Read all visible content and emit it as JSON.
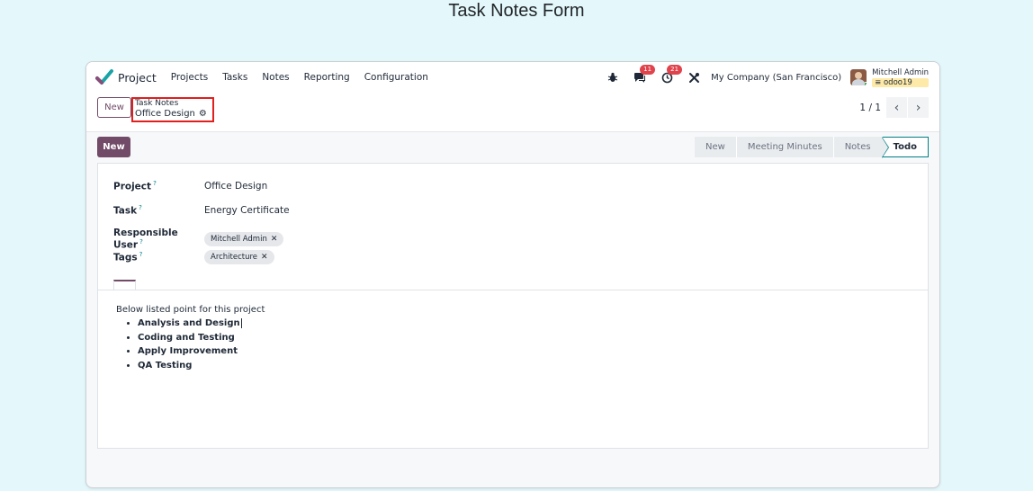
{
  "page_title": "Task Notes Form",
  "navbar": {
    "app_name": "Project",
    "menu": [
      "Projects",
      "Tasks",
      "Notes",
      "Reporting",
      "Configuration"
    ],
    "messages_badge": "11",
    "activities_badge": "21",
    "company": "My Company (San Francisco)",
    "user_name": "Mitchell Admin",
    "database": "odoo19"
  },
  "control_panel": {
    "new_label": "New",
    "breadcrumb_parent": "Task Notes",
    "breadcrumb_current": "Office Design",
    "pager": "1 / 1"
  },
  "statusbar": {
    "new_button": "New",
    "stages": [
      "New",
      "Meeting Minutes",
      "Notes",
      "Todo"
    ],
    "active_stage": "Todo"
  },
  "form": {
    "fields": [
      {
        "label": "Project",
        "value": "Office Design"
      },
      {
        "label": "Task",
        "value": "Energy Certificate"
      },
      {
        "label": "Responsible User",
        "value": "Mitchell Admin"
      },
      {
        "label": "Tags",
        "value": "Architecture"
      }
    ],
    "help_mark": "?",
    "notes_intro": "Below listed point for this project",
    "notes_points": [
      "Analysis and Design",
      "Coding and Testing",
      "Apply Improvement",
      "QA Testing"
    ]
  },
  "colors": {
    "brand": "#714b67",
    "accent": "#017e84",
    "background": "#e4f8fb",
    "highlight_box": "#e0201e"
  }
}
